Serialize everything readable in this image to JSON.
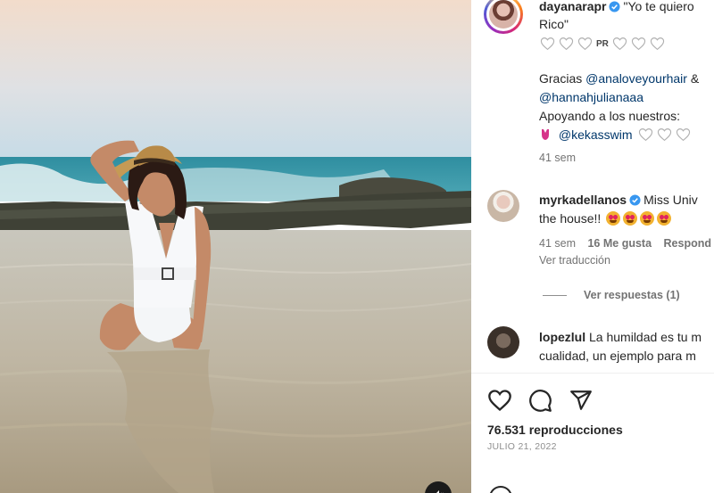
{
  "caption": {
    "username": "dayanarapr",
    "text": "\"Yo te quiero",
    "text_line2": "Rico\"",
    "tag_pr": "PR",
    "thanks_prefix": "Gracias",
    "mention_1": "@analoveyourhair",
    "mention_1_suffix": "&",
    "mention_2": "@hannahjulianaaa",
    "support_text": "Apoyando a los nuestros:",
    "mention_3": "@kekasswim",
    "time": "41 sem"
  },
  "comments": [
    {
      "username": "myrkadellanos",
      "text": "Miss Univ",
      "text_line2": "the house!!",
      "time": "41 sem",
      "likes": "16 Me gusta",
      "reply": "Respond",
      "translate": "Ver traducción",
      "view_replies": "Ver respuestas (1)"
    },
    {
      "username": "lopezlul",
      "text": "La humildad es tu m",
      "text_line2": "cualidad, un ejemplo para m"
    }
  ],
  "stats": {
    "views": "76.531 reproducciones",
    "date": "JULIO 21, 2022"
  },
  "icons": {
    "like": "heart-icon",
    "comment": "comment-icon",
    "share": "share-icon",
    "verified": "verified-badge-icon",
    "mute": "mute-icon"
  },
  "colors": {
    "verified": "#3897f0",
    "mention": "#00376b",
    "meta": "#737373",
    "emoji_face": "#f2b230"
  }
}
